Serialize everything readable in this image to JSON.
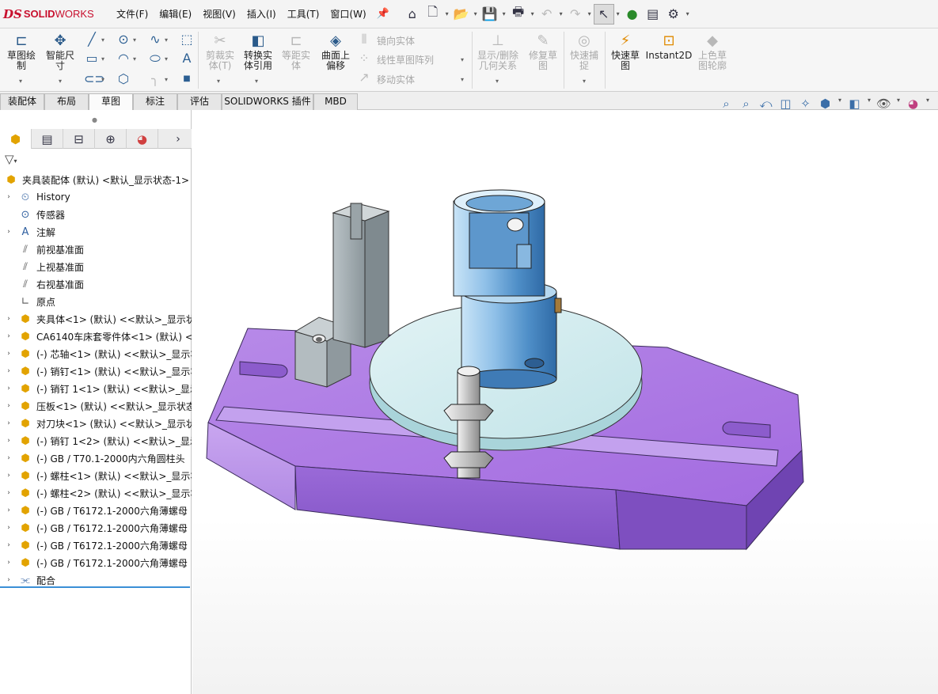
{
  "app": {
    "logo_prefix": "DS",
    "logo_solid": "SOLID",
    "logo_works": "WORKS"
  },
  "menu": [
    "文件(F)",
    "编辑(E)",
    "视图(V)",
    "插入(I)",
    "工具(T)",
    "窗口(W)"
  ],
  "quick_toolbar": {
    "icons": [
      "home-icon",
      "new-document-icon",
      "open-file-icon",
      "save-icon",
      "print-icon",
      "undo-icon",
      "redo-icon",
      "select-pointer-icon",
      "rebuild-traffic-light-icon",
      "file-properties-icon",
      "options-gear-icon"
    ]
  },
  "ribbon": {
    "sketch_button": "草图绘\n制",
    "smart_dimension": "智能尺\n寸",
    "trim_entities": "剪裁实\n体(T)",
    "convert_entities": "转换实\n体引用",
    "offset_entities": "等距实\n体",
    "offset_on_surface": "曲面上\n偏移",
    "mirror_entities": "镜向实体",
    "linear_sketch_pattern": "线性草图阵列",
    "move_entities": "移动实体",
    "display_delete_relations": "显示/删除\n几何关系",
    "repair_sketch": "修复草\n图",
    "quick_snaps": "快速捕\n捉",
    "rapid_sketch": "快速草\n图",
    "instant2d": "Instant2D",
    "shaded_sketch_contours": "上色草\n图轮廓"
  },
  "tabs": [
    {
      "label": "装配体",
      "active": false
    },
    {
      "label": "布局",
      "active": false
    },
    {
      "label": "草图",
      "active": true
    },
    {
      "label": "标注",
      "active": false
    },
    {
      "label": "评估",
      "active": false
    },
    {
      "label": "SOLIDWORKS 插件",
      "active": false
    },
    {
      "label": "MBD",
      "active": false
    }
  ],
  "panel_tabs": [
    "featuremanager-tree-icon",
    "propertymanager-icon",
    "configurationmanager-icon",
    "dimxpertmanager-icon",
    "displaymanager-icon"
  ],
  "tree": {
    "root": "夹具装配体 (默认) <默认_显示状态-1>",
    "items": [
      {
        "label": "History",
        "icon": "history-icon",
        "expand": true
      },
      {
        "label": "传感器",
        "icon": "sensor-icon",
        "expand": false
      },
      {
        "label": "注解",
        "icon": "annotation-icon",
        "expand": true
      },
      {
        "label": "前视基准面",
        "icon": "plane-icon",
        "expand": false
      },
      {
        "label": "上视基准面",
        "icon": "plane-icon",
        "expand": false
      },
      {
        "label": "右视基准面",
        "icon": "plane-icon",
        "expand": false
      },
      {
        "label": "原点",
        "icon": "origin-icon",
        "expand": false
      },
      {
        "label": "夹具体<1> (默认) <<默认>_显示状",
        "icon": "part-icon",
        "expand": true
      },
      {
        "label": "CA6140车床套零件体<1> (默认) <",
        "icon": "part-icon",
        "expand": true
      },
      {
        "label": "(-) 芯轴<1> (默认) <<默认>_显示状",
        "icon": "part-icon",
        "expand": true
      },
      {
        "label": "(-) 销钉<1> (默认) <<默认>_显示状",
        "icon": "part-icon",
        "expand": true
      },
      {
        "label": "(-) 销钉 1<1> (默认) <<默认>_显示",
        "icon": "part-icon",
        "expand": true
      },
      {
        "label": "压板<1> (默认) <<默认>_显示状态",
        "icon": "part-icon",
        "expand": true
      },
      {
        "label": "对刀块<1> (默认) <<默认>_显示状",
        "icon": "part-icon",
        "expand": true
      },
      {
        "label": "(-) 销钉 1<2> (默认) <<默认>_显示",
        "icon": "part-icon",
        "expand": true
      },
      {
        "label": "(-) GB / T70.1-2000内六角圆柱头",
        "icon": "part-icon",
        "expand": true
      },
      {
        "label": "(-) 螺柱<1> (默认) <<默认>_显示状",
        "icon": "part-icon",
        "expand": true
      },
      {
        "label": "(-) 螺柱<2> (默认) <<默认>_显示状",
        "icon": "part-icon",
        "expand": true
      },
      {
        "label": "(-) GB / T6172.1-2000六角薄螺母",
        "icon": "part-icon",
        "expand": true
      },
      {
        "label": "(-) GB / T6172.1-2000六角薄螺母",
        "icon": "part-icon",
        "expand": true
      },
      {
        "label": "(-) GB / T6172.1-2000六角薄螺母",
        "icon": "part-icon",
        "expand": true
      },
      {
        "label": "(-) GB / T6172.1-2000六角薄螺母",
        "icon": "part-icon",
        "expand": true
      },
      {
        "label": "配合",
        "icon": "mates-icon",
        "expand": true
      }
    ]
  },
  "colors": {
    "base_plate": "#b07ae6",
    "base_side": "#8e5ed0",
    "clamp_plate": "#cfe9ec",
    "mandrel": "#9fc6e8",
    "tool_block": "#9aa4a8",
    "tree_accent": "#3b8fd6"
  }
}
